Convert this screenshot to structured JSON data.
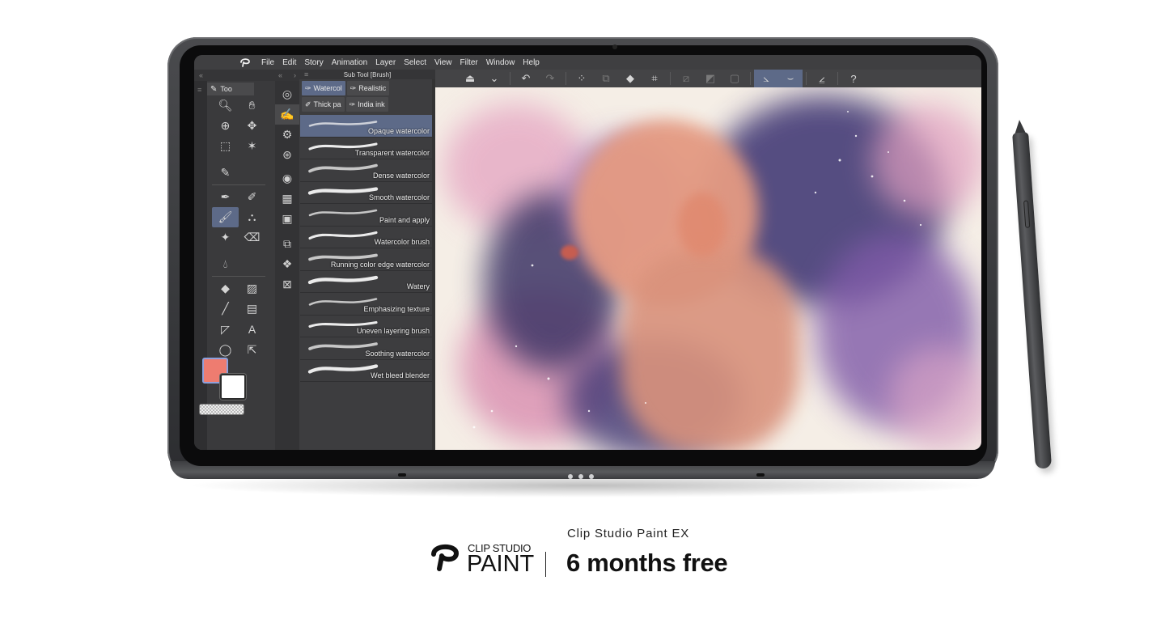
{
  "app": {
    "menu": [
      "File",
      "Edit",
      "Story",
      "Animation",
      "Layer",
      "Select",
      "View",
      "Filter",
      "Window",
      "Help"
    ]
  },
  "tool_panel": {
    "tab_label": "Too",
    "tools": [
      {
        "icon": "zoom-icon",
        "glyph": "🔍︎"
      },
      {
        "icon": "hand-icon",
        "glyph": "✋︎"
      },
      {
        "icon": "object-select-icon",
        "glyph": "⊕"
      },
      {
        "icon": "move-icon",
        "glyph": "✥"
      },
      {
        "icon": "rect-selection-icon",
        "glyph": "⬚"
      },
      {
        "icon": "magic-wand-icon",
        "glyph": "✶"
      },
      {
        "icon": "eyedropper-icon",
        "glyph": "✎"
      },
      {
        "icon": "blank",
        "glyph": ""
      },
      {
        "icon": "pen-icon",
        "glyph": "✒"
      },
      {
        "icon": "pencil-icon",
        "glyph": "✐"
      },
      {
        "icon": "brush-icon",
        "glyph": "🖌︎"
      },
      {
        "icon": "airbrush-icon",
        "glyph": "⛬"
      },
      {
        "icon": "decoration-icon",
        "glyph": "✦"
      },
      {
        "icon": "eraser-icon",
        "glyph": "⌫"
      },
      {
        "icon": "blend-icon",
        "glyph": "💧︎"
      },
      {
        "icon": "blank",
        "glyph": ""
      },
      {
        "icon": "fill-icon",
        "glyph": "◆"
      },
      {
        "icon": "gradient-icon",
        "glyph": "▨"
      },
      {
        "icon": "figure-icon",
        "glyph": "╱"
      },
      {
        "icon": "frame-border-icon",
        "glyph": "▤"
      },
      {
        "icon": "ruler-icon",
        "glyph": "◸"
      },
      {
        "icon": "text-icon",
        "glyph": "A"
      },
      {
        "icon": "balloon-icon",
        "glyph": "◯"
      },
      {
        "icon": "correct-line-icon",
        "glyph": "⇱"
      }
    ],
    "main_color": "#EE7C70",
    "sub_color": "#FFFFFF"
  },
  "sub_tool_groups": [
    {
      "icon": "target-icon",
      "glyph": "◎"
    },
    {
      "icon": "brush-group-icon",
      "glyph": "✍"
    },
    {
      "icon": "brush-settings-icon",
      "glyph": "⚙"
    },
    {
      "icon": "brush-target-icon",
      "glyph": "⊛"
    },
    {
      "icon": "circle-icon",
      "glyph": "◉"
    },
    {
      "icon": "color-grid-icon",
      "glyph": "▦"
    },
    {
      "icon": "filmstrip-icon",
      "glyph": "▣"
    },
    {
      "icon": "layer-props-icon",
      "glyph": "⧉"
    },
    {
      "icon": "layers-icon",
      "glyph": "❖"
    },
    {
      "icon": "close-panel-icon",
      "glyph": "⊠"
    }
  ],
  "sub_tool": {
    "title": "Sub Tool [Brush]",
    "tabs": [
      "Watercol",
      "Realistic",
      "Thick pa",
      "India ink"
    ],
    "active_tab": "Watercol",
    "brushes": [
      "Opaque watercolor",
      "Transparent watercolor",
      "Dense watercolor",
      "Smooth watercolor",
      "Paint and apply",
      "Watercolor brush",
      "Running color edge watercolor",
      "Watery",
      "Emphasizing texture",
      "Uneven layering brush",
      "Soothing watercolor",
      "Wet bleed blender"
    ],
    "selected_brush": "Opaque watercolor"
  },
  "command_bar": [
    {
      "icon": "save-icon",
      "glyph": "⏏"
    },
    {
      "icon": "chevron-down-icon",
      "glyph": "⌄"
    },
    {
      "icon": "undo-icon",
      "glyph": "↶"
    },
    {
      "icon": "redo-icon",
      "glyph": "↷"
    },
    {
      "icon": "deselect-icon",
      "glyph": "⁘"
    },
    {
      "icon": "selection-copy-icon",
      "glyph": "⧉"
    },
    {
      "icon": "fill-selection-icon",
      "glyph": "◆"
    },
    {
      "icon": "transform-icon",
      "glyph": "⌗"
    },
    {
      "icon": "clear-outside-icon",
      "glyph": "⧄"
    },
    {
      "icon": "tone-icon",
      "glyph": "◩"
    },
    {
      "icon": "frame-icon",
      "glyph": "▢"
    },
    {
      "icon": "snap-ruler-icon",
      "glyph": "⦣"
    },
    {
      "icon": "snap-special-icon",
      "glyph": "⌣"
    },
    {
      "icon": "snap-grid-icon",
      "glyph": "⦤"
    },
    {
      "icon": "help-icon",
      "glyph": "?"
    }
  ],
  "promo": {
    "brand_small": "CLIP STUDIO",
    "brand_big": "PAINT",
    "product": "Clip Studio Paint EX",
    "offer": "6 months free"
  }
}
